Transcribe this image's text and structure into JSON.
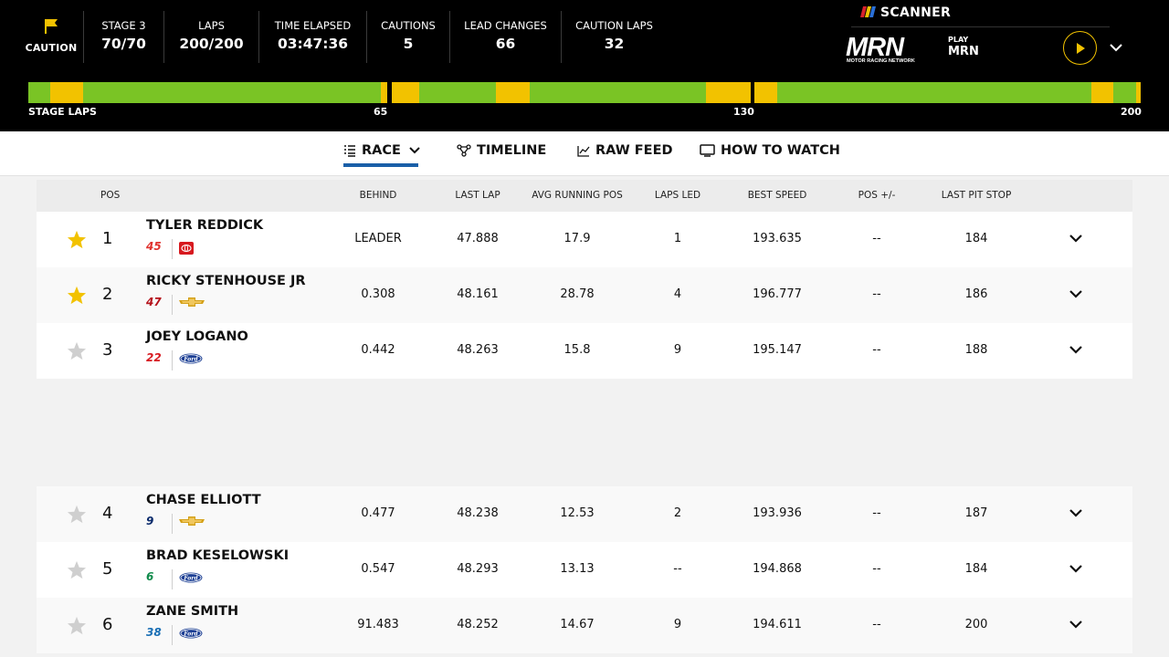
{
  "header": {
    "flag_label": "CAUTION",
    "stats": [
      {
        "label": "STAGE 3",
        "value": "70/70"
      },
      {
        "label": "LAPS",
        "value": "200/200"
      },
      {
        "label": "TIME ELAPSED",
        "value": "03:47:36"
      },
      {
        "label": "CAUTIONS",
        "value": "5"
      },
      {
        "label": "LEAD CHANGES",
        "value": "66"
      },
      {
        "label": "CAUTION LAPS",
        "value": "32"
      }
    ],
    "scanner_title": "SCANNER",
    "play_label": "PLAY",
    "station": "MRN",
    "logo_text": "MRN",
    "logo_subtext": "MOTOR RACING NETWORK"
  },
  "stage_bar": {
    "label": "STAGE LAPS",
    "ticks": [
      "65",
      "130",
      "200"
    ],
    "colors": {
      "green": "#7ac425",
      "yellow": "#f2c200"
    }
  },
  "nav": {
    "tabs": [
      {
        "label": "RACE",
        "active": true
      },
      {
        "label": "TIMELINE"
      },
      {
        "label": "RAW FEED"
      },
      {
        "label": "HOW TO WATCH"
      }
    ]
  },
  "table": {
    "columns": [
      "POS",
      "BEHIND",
      "LAST LAP",
      "AVG RUNNING POS",
      "LAPS LED",
      "BEST SPEED",
      "POS +/-",
      "LAST PIT STOP"
    ],
    "rows": [
      {
        "fav": true,
        "pos": "1",
        "driver": "TYLER REDDICK",
        "car": "45",
        "car_color": "#e0322e",
        "mfr": "toyota",
        "behind": "LEADER",
        "last_lap": "47.888",
        "avg_pos": "17.9",
        "laps_led": "1",
        "best_speed": "193.635",
        "pos_change": "--",
        "last_pit": "184"
      },
      {
        "fav": true,
        "pos": "2",
        "driver": "RICKY STENHOUSE JR",
        "car": "47",
        "car_color": "#b5121b",
        "mfr": "chevrolet",
        "behind": "0.308",
        "last_lap": "48.161",
        "avg_pos": "28.78",
        "laps_led": "4",
        "best_speed": "196.777",
        "pos_change": "--",
        "last_pit": "186"
      },
      {
        "fav": false,
        "pos": "3",
        "driver": "JOEY LOGANO",
        "car": "22",
        "car_color": "#d71920",
        "mfr": "ford",
        "behind": "0.442",
        "last_lap": "48.263",
        "avg_pos": "15.8",
        "laps_led": "9",
        "best_speed": "195.147",
        "pos_change": "--",
        "last_pit": "188"
      },
      {
        "fav": false,
        "pos": "4",
        "driver": "CHASE ELLIOTT",
        "car": "9",
        "car_color": "#0a2a6b",
        "mfr": "chevrolet",
        "behind": "0.477",
        "last_lap": "48.238",
        "avg_pos": "12.53",
        "laps_led": "2",
        "best_speed": "193.936",
        "pos_change": "--",
        "last_pit": "187"
      },
      {
        "fav": false,
        "pos": "5",
        "driver": "BRAD KESELOWSKI",
        "car": "6",
        "car_color": "#0f8a4a",
        "mfr": "ford",
        "behind": "0.547",
        "last_lap": "48.293",
        "avg_pos": "13.13",
        "laps_led": "--",
        "best_speed": "194.868",
        "pos_change": "--",
        "last_pit": "184"
      },
      {
        "fav": false,
        "pos": "6",
        "driver": "ZANE SMITH",
        "car": "38",
        "car_color": "#1a6fb5",
        "mfr": "ford",
        "behind": "91.483",
        "last_lap": "48.252",
        "avg_pos": "14.67",
        "laps_led": "9",
        "best_speed": "194.611",
        "pos_change": "--",
        "last_pit": "200"
      }
    ]
  }
}
